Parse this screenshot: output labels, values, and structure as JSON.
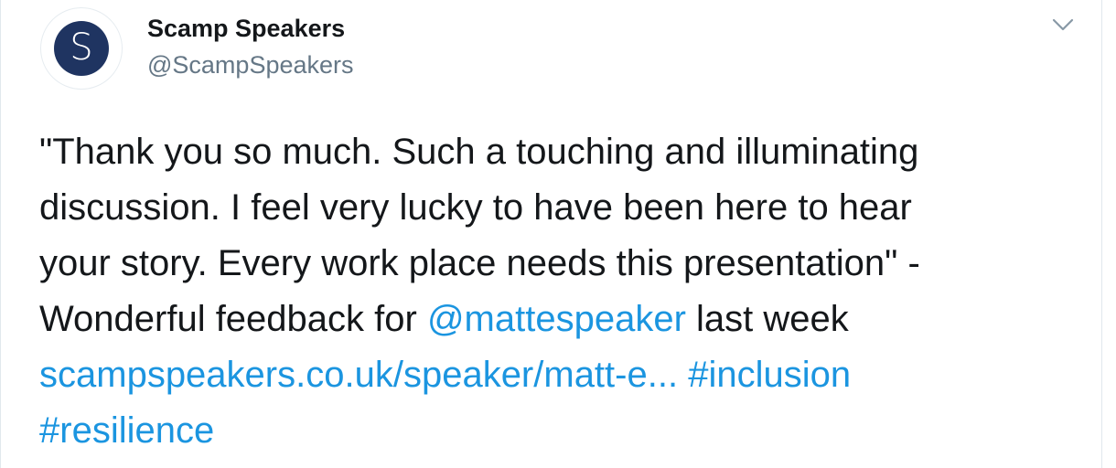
{
  "tweet": {
    "author": {
      "display_name": "Scamp Speakers",
      "handle": "@ScampSpeakers",
      "avatar_letter": "S",
      "avatar_color": "#1f3461"
    },
    "menu_icon": "chevron-down-icon",
    "text": {
      "line1": "\"Thank you so much. Such a touching and illuminating",
      "line2": "discussion. I feel very lucky to have been here to hear",
      "line3": "your story. Every work place needs this presentation\" -",
      "line4_prefix": "Wonderful feedback for ",
      "mention": "@mattespeaker",
      "line4_suffix": " last week",
      "url": "scampspeakers.co.uk/speaker/matt-e...",
      "hashtag1": "#inclusion",
      "hashtag2": "#resilience"
    },
    "colors": {
      "link": "#1b95e0",
      "text": "#14171a",
      "secondary": "#657786"
    }
  }
}
